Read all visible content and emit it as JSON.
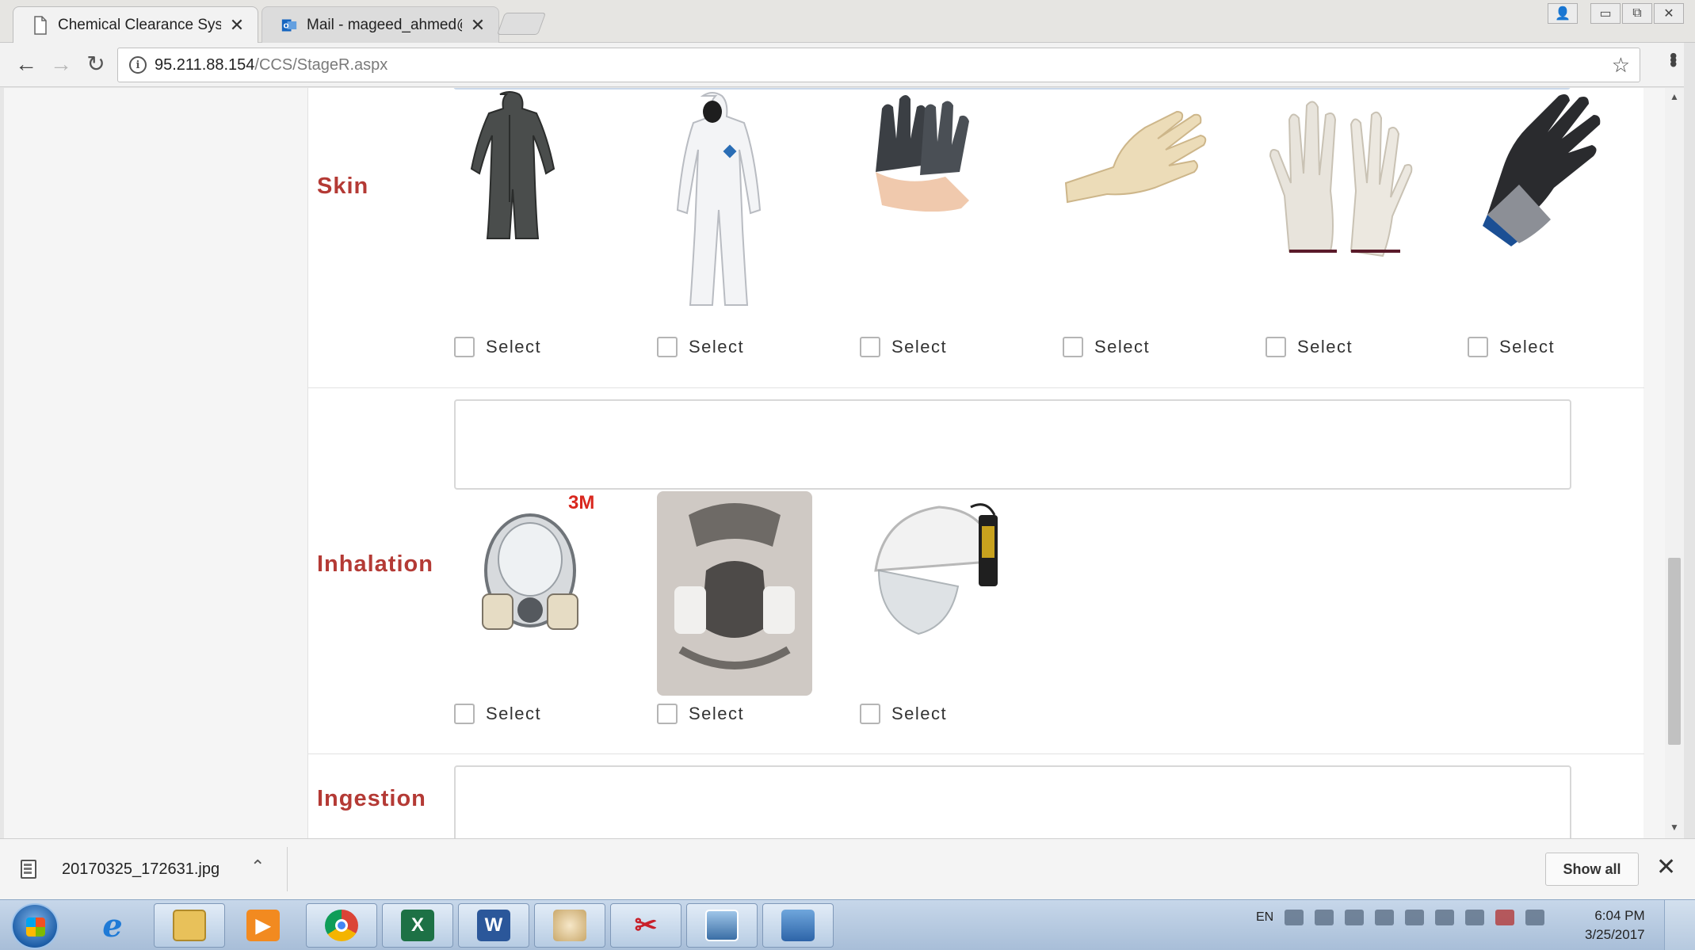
{
  "browser": {
    "tabs": [
      {
        "title": "Chemical Clearance Syste",
        "active": true
      },
      {
        "title": "Mail - mageed_ahmed@",
        "active": false
      }
    ],
    "url_host": "95.211.88.154",
    "url_path": "/CCS/StageR.aspx",
    "window_controls": [
      "profile-icon",
      "minimize-icon",
      "restore-icon",
      "close-icon"
    ]
  },
  "page": {
    "sections": {
      "skin": {
        "label": "Skin",
        "items": [
          {
            "icon": "dark-coverall-icon",
            "select": "Select"
          },
          {
            "icon": "white-coverall-icon",
            "select": "Select"
          },
          {
            "icon": "black-rubber-gloves-icon",
            "select": "Select"
          },
          {
            "icon": "latex-glove-icon",
            "select": "Select"
          },
          {
            "icon": "knit-gloves-icon",
            "select": "Select"
          },
          {
            "icon": "cut-resistant-glove-icon",
            "select": "Select"
          }
        ]
      },
      "inhalation": {
        "label": "Inhalation",
        "brand_mark": "3M",
        "items": [
          {
            "icon": "full-face-respirator-icon",
            "select": "Select"
          },
          {
            "icon": "half-mask-respirator-icon",
            "select": "Select"
          },
          {
            "icon": "powered-air-helmet-icon",
            "select": "Select"
          }
        ]
      },
      "ingestion": {
        "label": "Ingestion"
      }
    },
    "colors": {
      "section_label": "#b43a35"
    }
  },
  "downloads": {
    "file_name": "20170325_172631.jpg",
    "show_all": "Show all"
  },
  "taskbar": {
    "apps": [
      "internet-explorer-icon",
      "file-explorer-icon",
      "media-player-icon",
      "chrome-icon",
      "excel-icon",
      "word-icon",
      "paint-icon",
      "snipping-tool-icon",
      "photo-viewer-icon",
      "control-panel-icon"
    ],
    "language": "EN",
    "time": "6:04 PM",
    "date": "3/25/2017"
  }
}
